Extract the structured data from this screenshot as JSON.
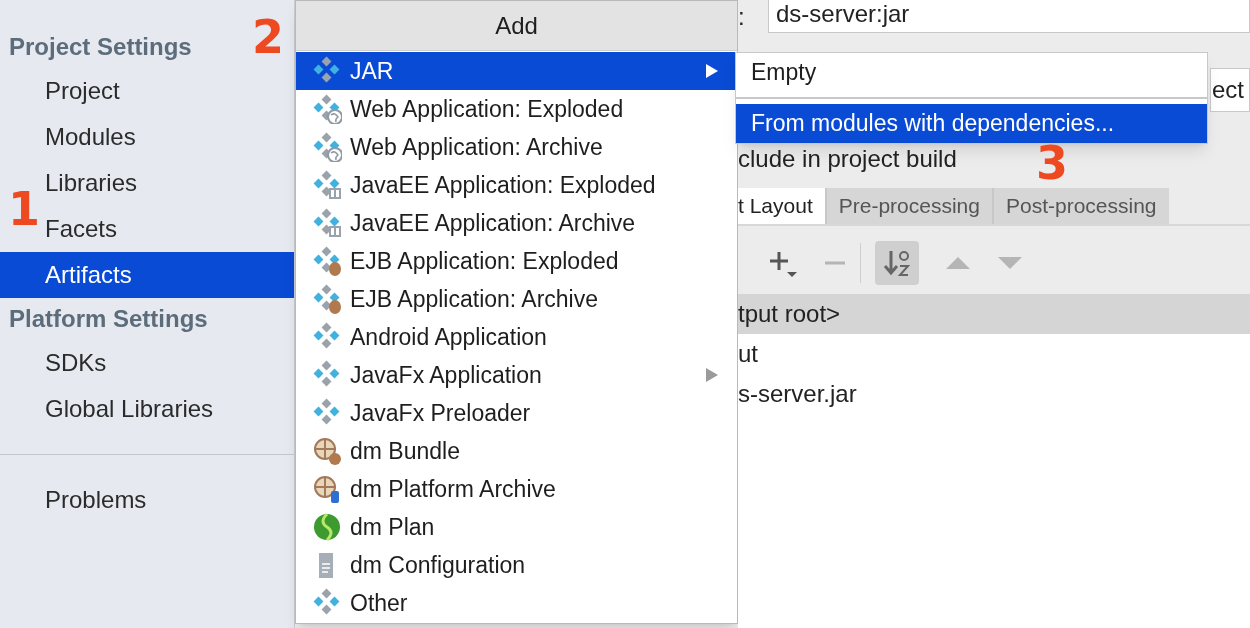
{
  "sidebar": {
    "sections": [
      {
        "title": "Project Settings",
        "items": [
          {
            "label": "Project",
            "selected": false
          },
          {
            "label": "Modules",
            "selected": false
          },
          {
            "label": "Libraries",
            "selected": false
          },
          {
            "label": "Facets",
            "selected": false
          },
          {
            "label": "Artifacts",
            "selected": true
          }
        ]
      },
      {
        "title": "Platform Settings",
        "items": [
          {
            "label": "SDKs",
            "selected": false
          },
          {
            "label": "Global Libraries",
            "selected": false
          }
        ]
      }
    ],
    "footer_items": [
      {
        "label": "Problems",
        "selected": false
      }
    ]
  },
  "artifact_panel": {
    "name_label": ":",
    "name_value": "ds-server:jar",
    "output_field_value": "ect",
    "include_label": "clude in project build",
    "tabs": [
      {
        "label": "t Layout",
        "selected": true
      },
      {
        "label": "Pre-processing",
        "selected": false
      },
      {
        "label": "Post-processing",
        "selected": false
      }
    ],
    "toolbar": [
      {
        "kind": "add",
        "disabled": false
      },
      {
        "kind": "remove",
        "disabled": true
      },
      {
        "kind": "sort",
        "disabled": false,
        "on": true
      },
      {
        "kind": "up",
        "disabled": true
      },
      {
        "kind": "down",
        "disabled": true
      }
    ],
    "tree": [
      {
        "label": "tput root>",
        "selected": true
      },
      {
        "label": "ut",
        "selected": false
      },
      {
        "label": "s-server.jar",
        "selected": false
      }
    ]
  },
  "add_menu": {
    "title": "Add",
    "items": [
      {
        "label": "JAR",
        "kind": "jar",
        "selected": true,
        "submenu": true
      },
      {
        "label": "Web Application: Exploded",
        "kind": "web",
        "selected": false,
        "submenu": false
      },
      {
        "label": "Web Application: Archive",
        "kind": "web",
        "selected": false,
        "submenu": false
      },
      {
        "label": "JavaEE Application: Exploded",
        "kind": "javaee",
        "selected": false,
        "submenu": false
      },
      {
        "label": "JavaEE Application: Archive",
        "kind": "javaee",
        "selected": false,
        "submenu": false
      },
      {
        "label": "EJB Application: Exploded",
        "kind": "ejb",
        "selected": false,
        "submenu": false
      },
      {
        "label": "EJB Application: Archive",
        "kind": "ejb",
        "selected": false,
        "submenu": false
      },
      {
        "label": "Android Application",
        "kind": "jar",
        "selected": false,
        "submenu": false
      },
      {
        "label": "JavaFx Application",
        "kind": "jar",
        "selected": false,
        "submenu": true
      },
      {
        "label": "JavaFx Preloader",
        "kind": "jar",
        "selected": false,
        "submenu": false
      },
      {
        "label": "dm Bundle",
        "kind": "dm-bundle",
        "selected": false,
        "submenu": false
      },
      {
        "label": "dm Platform Archive",
        "kind": "dm-platform",
        "selected": false,
        "submenu": false
      },
      {
        "label": "dm Plan",
        "kind": "dm-plan",
        "selected": false,
        "submenu": false
      },
      {
        "label": "dm Configuration",
        "kind": "config",
        "selected": false,
        "submenu": false
      },
      {
        "label": "Other",
        "kind": "jar",
        "selected": false,
        "submenu": false
      }
    ]
  },
  "jar_submenu": {
    "items": [
      {
        "label": "Empty",
        "selected": false
      },
      {
        "label": "From modules with dependencies...",
        "selected": true
      }
    ]
  },
  "annotations": [
    "2",
    "1",
    "3"
  ]
}
